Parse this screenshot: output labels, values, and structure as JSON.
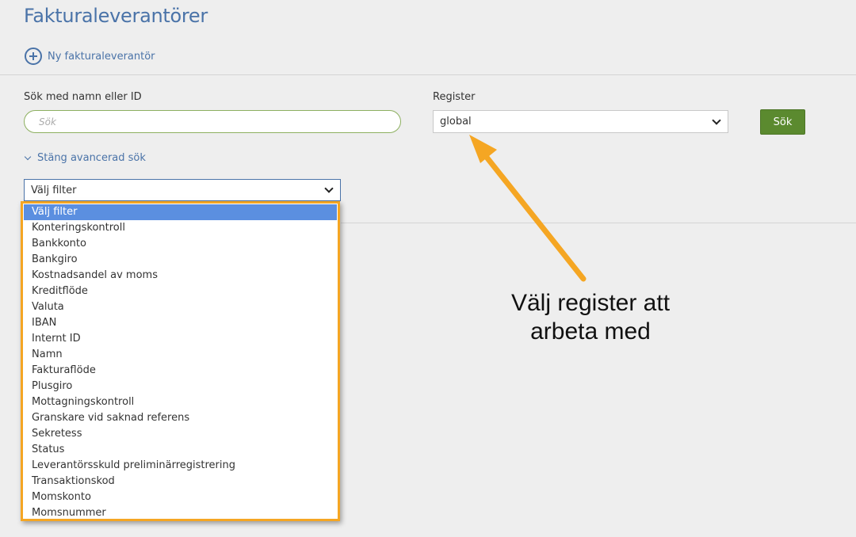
{
  "page": {
    "title": "Fakturaleverantörer",
    "new_link_label": "Ny fakturaleverantör"
  },
  "search": {
    "label": "Sök med namn eller ID",
    "placeholder": "Sök",
    "value": ""
  },
  "register": {
    "label": "Register",
    "value": "global"
  },
  "search_button_label": "Sök",
  "advanced": {
    "toggle_label": "Stäng avancerad sök"
  },
  "filter": {
    "value": "Välj filter",
    "options": [
      "Välj filter",
      "Konteringskontroll",
      "Bankkonto",
      "Bankgiro",
      "Kostnadsandel av moms",
      "Kreditflöde",
      "Valuta",
      "IBAN",
      "Internt ID",
      "Namn",
      "Fakturaflöde",
      "Plusgiro",
      "Mottagningskontroll",
      "Granskare vid saknad referens",
      "Sekretess",
      "Status",
      "Leverantörsskuld preliminärregistrering",
      "Transaktionskod",
      "Momskonto",
      "Momsnummer"
    ],
    "selected_index": 0
  },
  "annotation": {
    "line1": "Välj register att",
    "line2": "arbeta med"
  },
  "colors": {
    "accent": "#4a73a8",
    "button": "#5b8a2f",
    "highlight": "#f5a623",
    "selected_option": "#5b8fe0"
  },
  "icons": {
    "new": "plus-circle-icon",
    "select": "chevron-down-icon",
    "advanced": "chevron-down-icon"
  }
}
